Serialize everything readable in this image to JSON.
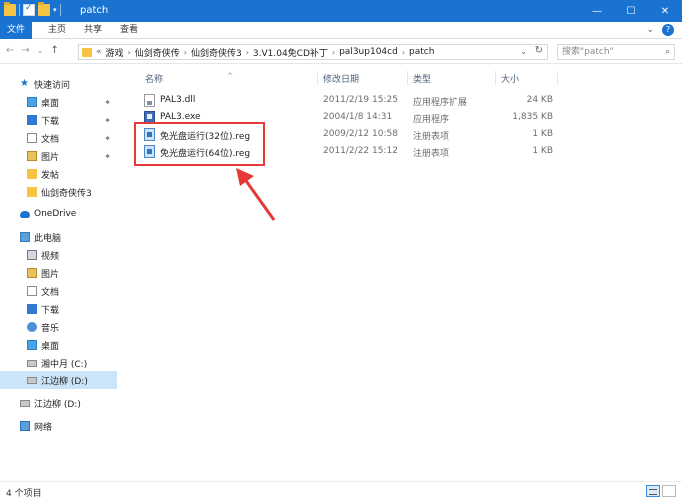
{
  "window": {
    "title": "patch",
    "accent": "#1a73d1",
    "buttons": {
      "minimize": "—",
      "maximize": "☐",
      "close": "✕"
    }
  },
  "ribbon": {
    "tabs": [
      "文件",
      "主页",
      "共享",
      "查看"
    ],
    "right_controls": {
      "expand": "⌄",
      "help": "?"
    }
  },
  "nav": {
    "back": "←",
    "forward": "→",
    "recent": "⌄",
    "up": "↑"
  },
  "address": {
    "prefix": "«",
    "crumbs": [
      "游戏",
      "仙剑奇侠传",
      "仙剑奇侠传3",
      "3.V1.04免CD补丁",
      "pal3up104cd",
      "patch"
    ],
    "separator": "›",
    "dropdown": "⌄",
    "refresh": "↻"
  },
  "search": {
    "placeholder": "搜索\"patch\"",
    "icon": "search-icon"
  },
  "sidebar": {
    "quick_access": {
      "label": "快速访问",
      "items": [
        {
          "label": "桌面",
          "icon": "desktop-icon",
          "pinned": true
        },
        {
          "label": "下载",
          "icon": "download-icon",
          "pinned": true
        },
        {
          "label": "文档",
          "icon": "document-icon",
          "pinned": true
        },
        {
          "label": "图片",
          "icon": "pictures-icon",
          "pinned": true
        },
        {
          "label": "发帖",
          "icon": "folder-icon",
          "pinned": false
        },
        {
          "label": "仙剑奇侠传3",
          "icon": "folder-icon",
          "pinned": false
        }
      ]
    },
    "onedrive": {
      "label": "OneDrive"
    },
    "this_pc": {
      "label": "此电脑",
      "items": [
        {
          "label": "视频",
          "icon": "video-icon"
        },
        {
          "label": "图片",
          "icon": "pictures-icon"
        },
        {
          "label": "文档",
          "icon": "document-icon"
        },
        {
          "label": "下载",
          "icon": "download-icon"
        },
        {
          "label": "音乐",
          "icon": "music-icon"
        },
        {
          "label": "桌面",
          "icon": "desktop-icon"
        },
        {
          "label": "湘中月 (C:)",
          "icon": "drive-icon"
        },
        {
          "label": "江边柳 (D:)",
          "icon": "drive-icon",
          "selected": true
        }
      ]
    },
    "drive_d": {
      "label": "江边柳 (D:)"
    },
    "network": {
      "label": "网络"
    },
    "pin_glyph": "📌"
  },
  "columns": {
    "name": "名称",
    "modified": "修改日期",
    "type": "类型",
    "size": "大小",
    "sort_glyph": "^"
  },
  "files": [
    {
      "name": "PAL3.dll",
      "modified": "2011/2/19 15:25",
      "type": "应用程序扩展",
      "size": "24 KB",
      "icon": "dll-file-icon"
    },
    {
      "name": "PAL3.exe",
      "modified": "2004/1/8 14:31",
      "type": "应用程序",
      "size": "1,835 KB",
      "icon": "exe-file-icon"
    },
    {
      "name": "免光盘运行(32位).reg",
      "modified": "2009/2/12 10:58",
      "type": "注册表项",
      "size": "1 KB",
      "icon": "reg-file-icon"
    },
    {
      "name": "免光盘运行(64位).reg",
      "modified": "2011/2/22 15:12",
      "type": "注册表项",
      "size": "1 KB",
      "icon": "reg-file-icon"
    }
  ],
  "annotation": {
    "box_color": "#e53935",
    "arrow_color": "#e53935"
  },
  "status": {
    "count": "4 个项目"
  }
}
